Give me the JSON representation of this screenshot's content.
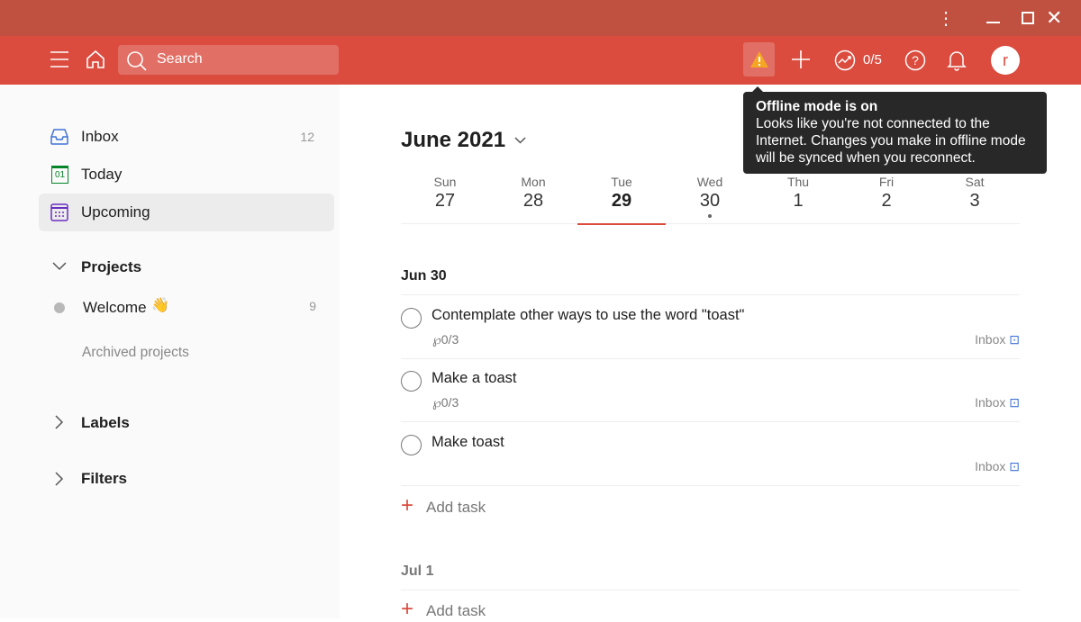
{
  "header": {
    "search_placeholder": "Search",
    "karma": "0/5",
    "avatar_initial": "r"
  },
  "tooltip": {
    "title": "Offline mode is on",
    "body": "Looks like you're not connected to the Internet. Changes you make in offline mode will be synced when you reconnect."
  },
  "sidebar": {
    "items": [
      {
        "label": "Inbox",
        "count": "12"
      },
      {
        "label": "Today",
        "icon_text": "01"
      },
      {
        "label": "Upcoming"
      }
    ],
    "projects_label": "Projects",
    "projects": [
      {
        "label": "Welcome",
        "emoji": "👋",
        "count": "9"
      }
    ],
    "archived": "Archived projects",
    "labels": "Labels",
    "filters": "Filters"
  },
  "main": {
    "month": "June 2021",
    "days": [
      {
        "name": "Sun",
        "num": "27"
      },
      {
        "name": "Mon",
        "num": "28"
      },
      {
        "name": "Tue",
        "num": "29"
      },
      {
        "name": "Wed",
        "num": "30"
      },
      {
        "name": "Thu",
        "num": "1"
      },
      {
        "name": "Fri",
        "num": "2"
      },
      {
        "name": "Sat",
        "num": "3"
      }
    ],
    "sections": [
      {
        "title": "Jun 30",
        "tasks": [
          {
            "title": "Contemplate other ways to use the word \"toast\"",
            "subtasks": "0/3",
            "project": "Inbox"
          },
          {
            "title": "Make a toast",
            "subtasks": "0/3",
            "project": "Inbox"
          },
          {
            "title": "Make toast",
            "project": "Inbox"
          }
        ],
        "add": "Add task"
      },
      {
        "title": "Jul 1",
        "add": "Add task"
      }
    ]
  },
  "colors": {
    "brand": "#db4c3f",
    "titlebar": "#c0503f",
    "warning": "#f5a623"
  }
}
